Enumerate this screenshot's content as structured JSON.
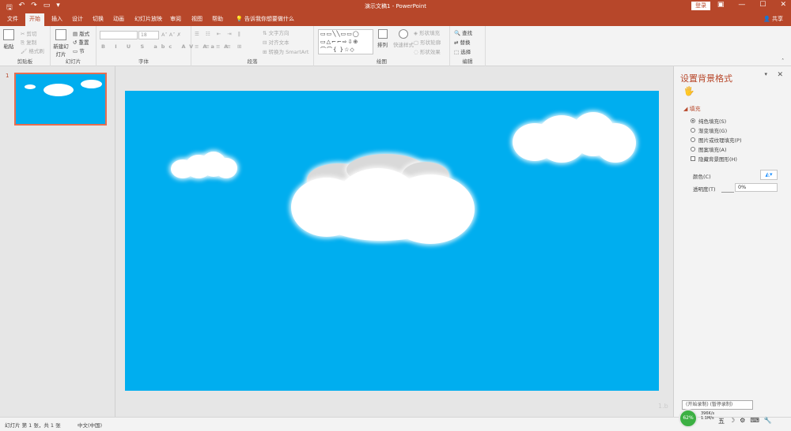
{
  "title_bar": {
    "document_title": "演示文稿1",
    "app_name": "PowerPoint",
    "login_label": "登录",
    "qat_icons": [
      "save-icon",
      "undo-icon",
      "redo-icon",
      "slideshow-icon",
      "customize-icon"
    ]
  },
  "tabs": [
    "文件",
    "开始",
    "插入",
    "设计",
    "切换",
    "动画",
    "幻灯片放映",
    "审阅",
    "视图",
    "帮助"
  ],
  "active_tab": "开始",
  "tell_me": "告诉我你想要做什么",
  "share_label": "共享",
  "ribbon": {
    "clipboard": {
      "label": "剪贴板",
      "paste": "粘贴",
      "cut": "剪切",
      "copy": "复制",
      "format_painter": "格式刷"
    },
    "slides": {
      "label": "幻灯片",
      "new_slide": "新建幻灯片",
      "layout": "版式",
      "reset": "重置",
      "section": "节"
    },
    "font": {
      "label": "字体",
      "font_size": "18"
    },
    "paragraph": {
      "label": "段落",
      "text_direction": "文字方向",
      "align_text": "对齐文本",
      "smartart": "转换为 SmartArt"
    },
    "drawing": {
      "label": "绘图",
      "arrange": "排列",
      "quick_styles": "快速样式",
      "shape_fill": "形状填充",
      "shape_outline": "形状轮廓",
      "shape_effects": "形状效果"
    },
    "editing": {
      "label": "编辑",
      "find": "查找",
      "replace": "替换",
      "select": "选择"
    }
  },
  "thumbnail_number": "1",
  "format_pane": {
    "title": "设置背景格式",
    "section": "填充",
    "options": [
      "纯色填充(S)",
      "渐变填充(G)",
      "图片或纹理填充(P)",
      "图案填充(A)"
    ],
    "selected_option": "纯色填充(S)",
    "hide_bg_graphics": "隐藏背景图形(H)",
    "color_label": "颜色(C)",
    "transparency_label": "透明度(T)",
    "transparency_value": "0%"
  },
  "status_bar": {
    "slide_info": "幻灯片 第 1 张，共 1 张",
    "language": "中文(中国)"
  },
  "floating_toolbar": "(开始录制)  (暂停录制)",
  "network": {
    "percent": "62%",
    "up": "396K/s",
    "down": "1.1M/s"
  },
  "colors": {
    "accent": "#b7472a",
    "slide_bg": "#00aeef"
  }
}
